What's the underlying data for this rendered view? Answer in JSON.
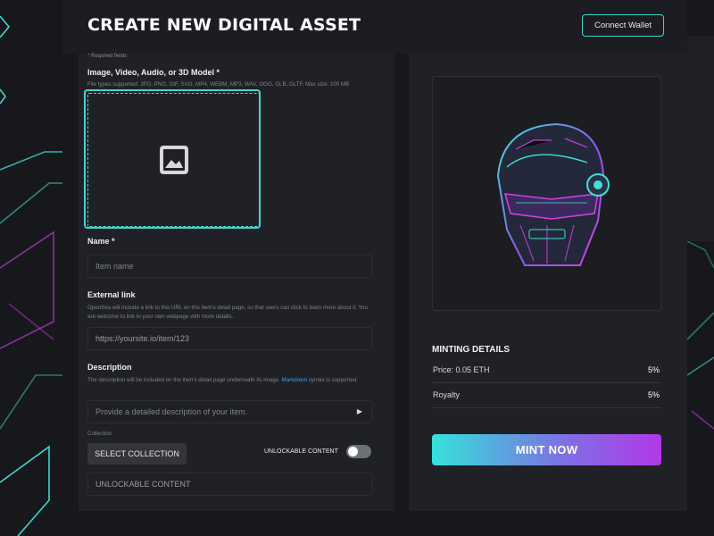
{
  "header": {
    "title": "CREATE NEW DIGITAL ASSET",
    "connect_wallet": "Connect Wallet"
  },
  "form": {
    "required_note": "* Required fields",
    "media": {
      "label": "Image, Video, Audio, or 3D Model *",
      "hint": "File types supported: JPG, PNG, GIF, SVG, MP4, WEBM, MP3, WAV, OGG, GLB, GLTF. Max size: 100 MB"
    },
    "name": {
      "label": "Name *",
      "placeholder": "Item name"
    },
    "external_link": {
      "label": "External link",
      "hint": "OpenSea will include a link to this URL on this item's detail page, so that users can click to learn more about it. You are welcome to link to your own webpage with more details.",
      "value": "https://yoursite.io/item/123"
    },
    "description": {
      "label": "Description",
      "hint_before": "The description will be included on the item's detail page underneath its image.",
      "hint_link": "Markdown",
      "hint_after": "syntax is supported.",
      "placeholder": "Provide a detailed description of your item."
    },
    "collection": {
      "label": "Collection",
      "button": "SELECT COLLECTION"
    },
    "unlockable": {
      "toggle_label": "UNLOCKABLE CONTENT",
      "toggle_on": false,
      "field": "UNLOCKABLE CONTENT"
    }
  },
  "minting": {
    "title": "MINTING DETAILS",
    "rows": [
      {
        "key": "Price: 0.05 ETH",
        "value": "5%"
      },
      {
        "key": "Royalty",
        "value": "5%"
      }
    ],
    "button": "MINT NOW"
  },
  "colors": {
    "accent_cyan": "#3fd6cf",
    "accent_purple": "#b337e8",
    "link_blue": "#3aa0e0"
  },
  "icons": {
    "upload": "image-placeholder-icon",
    "preview": "cyber-helmet-image"
  }
}
